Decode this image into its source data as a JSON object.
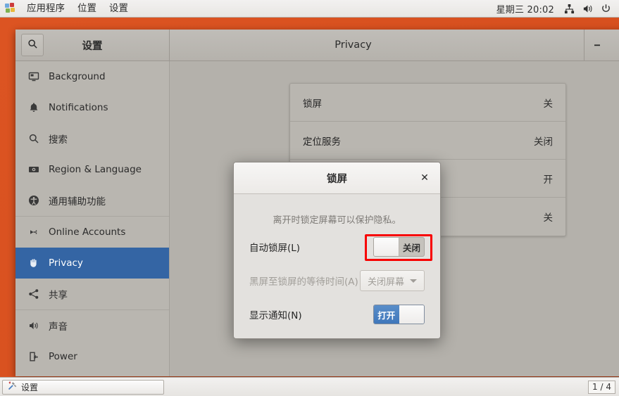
{
  "top_panel": {
    "menus": [
      "应用程序",
      "位置",
      "设置"
    ],
    "clock": "星期三 20:02",
    "tray": [
      {
        "name": "network-icon",
        "label": "network"
      },
      {
        "name": "volume-icon",
        "label": "volume"
      },
      {
        "name": "power-icon",
        "label": "power"
      }
    ]
  },
  "bottom_panel": {
    "task_label": "设置",
    "task_icon": "tools-icon",
    "workspace": "1 / 4"
  },
  "window": {
    "sidebar_title": "设置",
    "content_title": "Privacy",
    "search_icon": "search-icon",
    "controls": {
      "minimize": "−",
      "maximize": "□"
    }
  },
  "sidebar": {
    "items": [
      {
        "label": "Background",
        "icon": "monitor-icon",
        "selected": false
      },
      {
        "label": "Notifications",
        "icon": "bell-icon",
        "selected": false
      },
      {
        "label": "搜索",
        "icon": "search-icon",
        "selected": false
      },
      {
        "label": "Region & Language",
        "icon": "flag-icon",
        "selected": false
      },
      {
        "label": "通用辅助功能",
        "icon": "accessibility-icon",
        "selected": false
      },
      {
        "label": "Online Accounts",
        "icon": "plug-icon",
        "selected": false
      },
      {
        "label": "Privacy",
        "icon": "hand-icon",
        "selected": true
      },
      {
        "label": "共享",
        "icon": "share-icon",
        "selected": false
      },
      {
        "label": "声音",
        "icon": "speaker-icon",
        "selected": false
      },
      {
        "label": "Power",
        "icon": "battery-icon",
        "selected": false
      }
    ]
  },
  "privacy_panel": {
    "rows": [
      {
        "label": "锁屏",
        "value": "关"
      },
      {
        "label": "定位服务",
        "value": "关闭"
      },
      {
        "label": "",
        "value": "开"
      },
      {
        "label": "",
        "value": "关"
      }
    ]
  },
  "dialog": {
    "title": "锁屏",
    "close_icon": "close-icon",
    "description": "离开时锁定屏幕可以保护隐私。",
    "rows": [
      {
        "label": "自动锁屏(L)",
        "control": "switch",
        "state": "off",
        "on_label": "打开",
        "off_label": "关闭",
        "highlighted": true
      },
      {
        "label": "黑屏至锁屏的等待时间(A)",
        "control": "combo",
        "value": "关闭屏幕",
        "disabled": true
      },
      {
        "label": "显示通知(N)",
        "control": "switch",
        "state": "on",
        "on_label": "打开",
        "off_label": "关闭",
        "highlighted": false
      }
    ]
  },
  "colors": {
    "accent": "#3465a4",
    "titlebar_orange": "#d9501f",
    "annotation": "#f70000",
    "switch_on": "#3f77bb"
  }
}
